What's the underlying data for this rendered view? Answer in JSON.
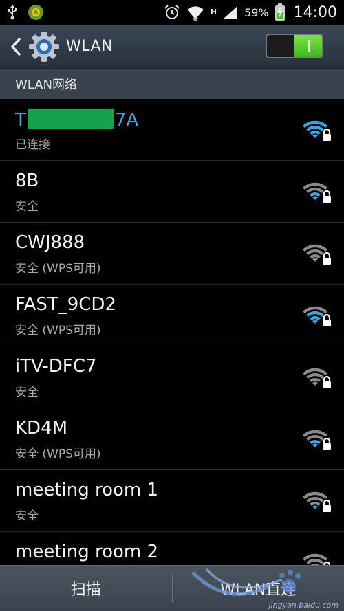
{
  "status_bar": {
    "icons": [
      "usb-icon",
      "app-notification-icon",
      "alarm-icon",
      "wifi-signal-icon",
      "cell-signal-icon",
      "battery-charging-icon"
    ],
    "network_type": "H",
    "battery": "59%",
    "time": "14:00"
  },
  "action_bar": {
    "title": "WLAN",
    "wlan_enabled": true,
    "colors": {
      "toggle_on": "#4ccc2a"
    }
  },
  "section": {
    "title": "WLAN网络"
  },
  "networks": [
    {
      "name_prefix": "T",
      "name_suffix": "7A",
      "status": "已连接",
      "connected": true,
      "secured": true,
      "signal_level": 4
    },
    {
      "name": "8B",
      "status": "安全",
      "connected": false,
      "secured": true,
      "signal_level": 2
    },
    {
      "name": "CWJ888",
      "status": "安全 (WPS可用)",
      "connected": false,
      "secured": true,
      "signal_level": 0
    },
    {
      "name": "FAST_9CD2",
      "status": "安全 (WPS可用)",
      "connected": false,
      "secured": true,
      "signal_level": 3
    },
    {
      "name": "iTV-DFC7",
      "status": "安全",
      "connected": false,
      "secured": true,
      "signal_level": 0
    },
    {
      "name": "KD4M",
      "status": "安全 (WPS可用)",
      "connected": false,
      "secured": true,
      "signal_level": 2
    },
    {
      "name": "meeting room 1",
      "status": "安全",
      "connected": false,
      "secured": true,
      "signal_level": 1
    },
    {
      "name": "meeting room 2",
      "status": "",
      "connected": false,
      "secured": true,
      "signal_level": 0
    }
  ],
  "bottom_bar": {
    "scan_label": "扫描",
    "wifi_direct_label": "WLAN直连"
  },
  "watermark": {
    "text": "jingyan.baidu.com"
  },
  "colors": {
    "connected_name": "#3aa7e0",
    "signal_active": "#3aa7e0",
    "signal_inactive": "#8a8a8a",
    "redaction": "#14a24c"
  }
}
